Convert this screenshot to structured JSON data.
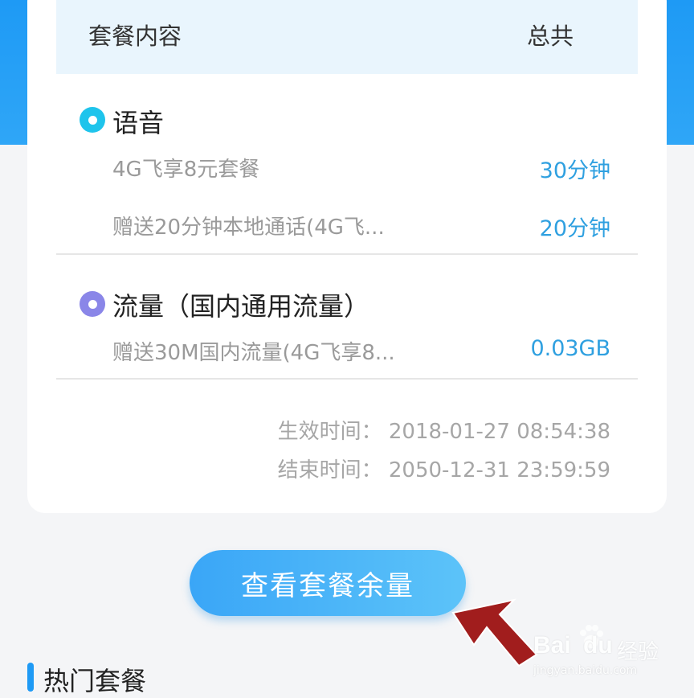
{
  "table_header": {
    "left": "套餐内容",
    "right": "总共"
  },
  "sections": [
    {
      "title": "语音",
      "items": [
        {
          "name": "4G飞享8元套餐",
          "value": "30分钟"
        },
        {
          "name": "赠送20分钟本地通话(4G飞...",
          "value": "20分钟"
        }
      ]
    },
    {
      "title": "流量（国内通用流量）",
      "items": [
        {
          "name": "赠送30M国内流量(4G飞享8...",
          "value": "0.03GB"
        }
      ]
    }
  ],
  "validity": {
    "start_label": "生效时间：",
    "start_value": "2018-01-27 08:54:38",
    "end_label": "结束时间：",
    "end_value": "2050-12-31 23:59:59"
  },
  "button": {
    "label": "查看套餐余量"
  },
  "hot": {
    "title": "热门套餐"
  },
  "watermark": {
    "brand": "Bai",
    "brand2": "du",
    "cn": "经验",
    "url": "jingyan.baidu.com"
  },
  "colors": {
    "accent": "#1e9af5",
    "value_blue": "#2fa0e0",
    "voice_dot": "#1fc4ec",
    "data_dot": "#8a86e8",
    "arrow": "#a11d1d"
  },
  "icons": [
    "voice-dot-icon",
    "data-dot-icon",
    "arrow-pointer-icon",
    "baidu-paw-icon"
  ]
}
